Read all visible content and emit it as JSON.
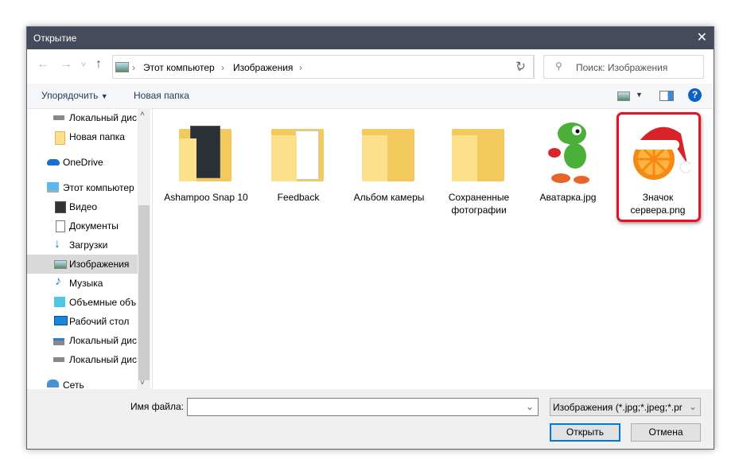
{
  "window": {
    "title": "Открытие",
    "close": "✕"
  },
  "nav": {
    "back": "←",
    "forward": "→",
    "recent": "˅",
    "up": "↑",
    "breadcrumb": [
      "Этот компьютер",
      "Изображения"
    ],
    "refresh": "↻",
    "search_placeholder": "Поиск: Изображения"
  },
  "toolbar": {
    "organize": "Упорядочить",
    "new_folder": "Новая папка",
    "help": "?"
  },
  "sidebar": {
    "items": [
      {
        "label": "Локальный дис",
        "icon": "drive-icon"
      },
      {
        "label": "Новая папка",
        "icon": "folder-icon"
      },
      {
        "label": "OneDrive",
        "icon": "cloud-icon"
      },
      {
        "label": "Этот компьютер",
        "icon": "computer-icon"
      },
      {
        "label": "Видео",
        "icon": "video-icon"
      },
      {
        "label": "Документы",
        "icon": "document-icon"
      },
      {
        "label": "Загрузки",
        "icon": "download-icon"
      },
      {
        "label": "Изображения",
        "icon": "pictures-icon",
        "selected": true
      },
      {
        "label": "Музыка",
        "icon": "music-icon"
      },
      {
        "label": "Объемные объ",
        "icon": "3d-objects-icon"
      },
      {
        "label": "Рабочий стол",
        "icon": "desktop-icon"
      },
      {
        "label": "Локальный дис",
        "icon": "system-drive-icon"
      },
      {
        "label": "Локальный дис",
        "icon": "drive-icon"
      },
      {
        "label": "Сеть",
        "icon": "network-icon"
      }
    ]
  },
  "files": [
    {
      "label": "Ashampoo Snap 10",
      "type": "folder"
    },
    {
      "label": "Feedback",
      "type": "folder"
    },
    {
      "label": "Альбом камеры",
      "type": "folder"
    },
    {
      "label": "Сохраненные фотографии",
      "type": "folder"
    },
    {
      "label": "Аватарка.jpg",
      "type": "image"
    },
    {
      "label": "Значок сервера.png",
      "type": "image",
      "highlighted": true
    }
  ],
  "footer": {
    "filename_label": "Имя файла:",
    "filename_value": "",
    "filter": "Изображения (*.jpg;*.jpeg;*.pr",
    "open": "Открыть",
    "cancel": "Отмена"
  },
  "colors": {
    "titlebar": "#444b5a",
    "highlight": "#e81123",
    "accent": "#0078d7"
  }
}
